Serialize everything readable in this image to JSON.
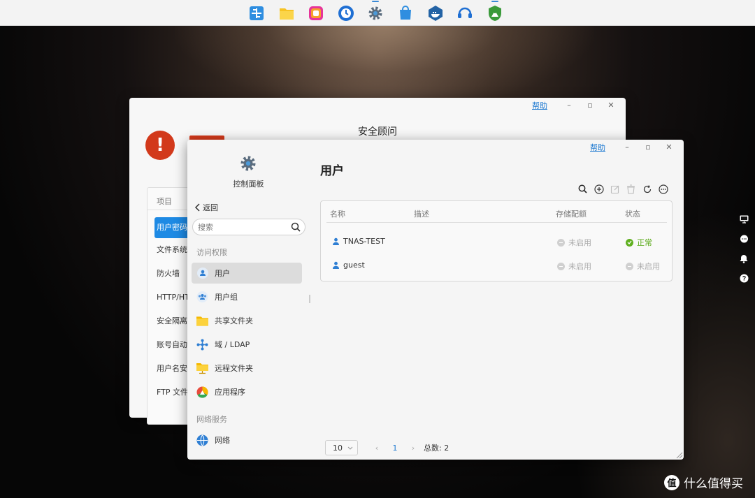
{
  "dock": {
    "apps": [
      {
        "icon": "app-center-icon",
        "color": "#2f8ee0"
      },
      {
        "icon": "file-manager-icon",
        "color": "#f7c323"
      },
      {
        "icon": "photos-icon",
        "color": "#e6359a"
      },
      {
        "icon": "backup-clock-icon",
        "color": "#1f6fd3"
      },
      {
        "icon": "control-panel-icon",
        "color": "#4b9ad9"
      },
      {
        "icon": "app-store-icon",
        "color": "#2f8ee0"
      },
      {
        "icon": "docker-icon",
        "color": "#2363a5"
      },
      {
        "icon": "support-headset-icon",
        "color": "#1f6fd3"
      },
      {
        "icon": "security-advisor-icon",
        "color": "#3a9a3a"
      }
    ]
  },
  "security_window": {
    "help": "帮助",
    "title": "安全顾问",
    "panel_header": "项目",
    "items": [
      "用户密码",
      "文件系统",
      "防火墙",
      "HTTP/HT",
      "安全隔离",
      "账号自动",
      "用户名安",
      "FTP 文件"
    ]
  },
  "control_panel": {
    "help": "帮助",
    "app_title": "控制面板",
    "back_label": "返回",
    "search_placeholder": "搜索",
    "section_access": "访问权限",
    "nav_access": [
      {
        "label": "用户",
        "icon": "user-icon"
      },
      {
        "label": "用户组",
        "icon": "user-group-icon"
      },
      {
        "label": "共享文件夹",
        "icon": "shared-folder-icon"
      },
      {
        "label": "域 / LDAP",
        "icon": "domain-ldap-icon"
      },
      {
        "label": "远程文件夹",
        "icon": "remote-folder-icon"
      },
      {
        "label": "应用程序",
        "icon": "applications-icon"
      }
    ],
    "section_network": "网络服务",
    "nav_network": [
      {
        "label": "网络",
        "icon": "network-globe-icon"
      }
    ],
    "page_title": "用户",
    "columns": [
      "名称",
      "描述",
      "存储配额",
      "状态"
    ],
    "users": [
      {
        "name": "TNAS-TEST",
        "description": "",
        "quota": "未启用",
        "status": "正常",
        "status_ok": true
      },
      {
        "name": "guest",
        "description": "",
        "quota": "未启用",
        "status": "未启用",
        "status_ok": false
      }
    ],
    "pagination": {
      "page_size": "10",
      "current_page": "1",
      "total": "总数: 2"
    }
  },
  "watermark": {
    "badge": "值",
    "text": "什么值得买"
  },
  "colors": {
    "accent": "#1e8ae4",
    "ok": "#57a814",
    "alert": "#d2391b"
  }
}
